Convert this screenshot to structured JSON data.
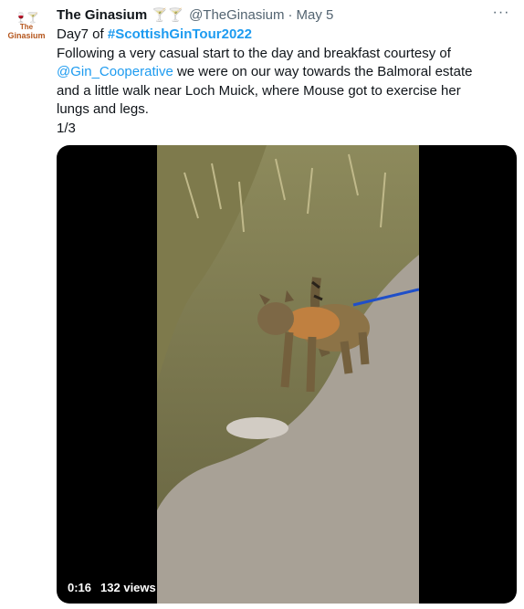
{
  "tweet": {
    "author_name": "The Ginasium",
    "author_emoji": "🍸🍸",
    "handle": "@TheGinasium",
    "separator": "·",
    "date": "May 5",
    "more_label": "···",
    "text": {
      "day_prefix": "Day7 of ",
      "hashtag": "#ScottishGinTour2022",
      "line2_before": "Following a very casual start to the day and breakfast courtesy of",
      "mention": "@Gin_Cooperative",
      "line2_after": " we were on our way towards the Balmoral estate and a little walk near Loch Muick, where Mouse got to exercise her lungs and legs.",
      "counter": "1/3"
    }
  },
  "avatar": {
    "icon": "cocktail-glasses-icon",
    "brand_top": "The",
    "brand_main": "Ginasium"
  },
  "video": {
    "duration": "0:16",
    "views": "132 views"
  }
}
